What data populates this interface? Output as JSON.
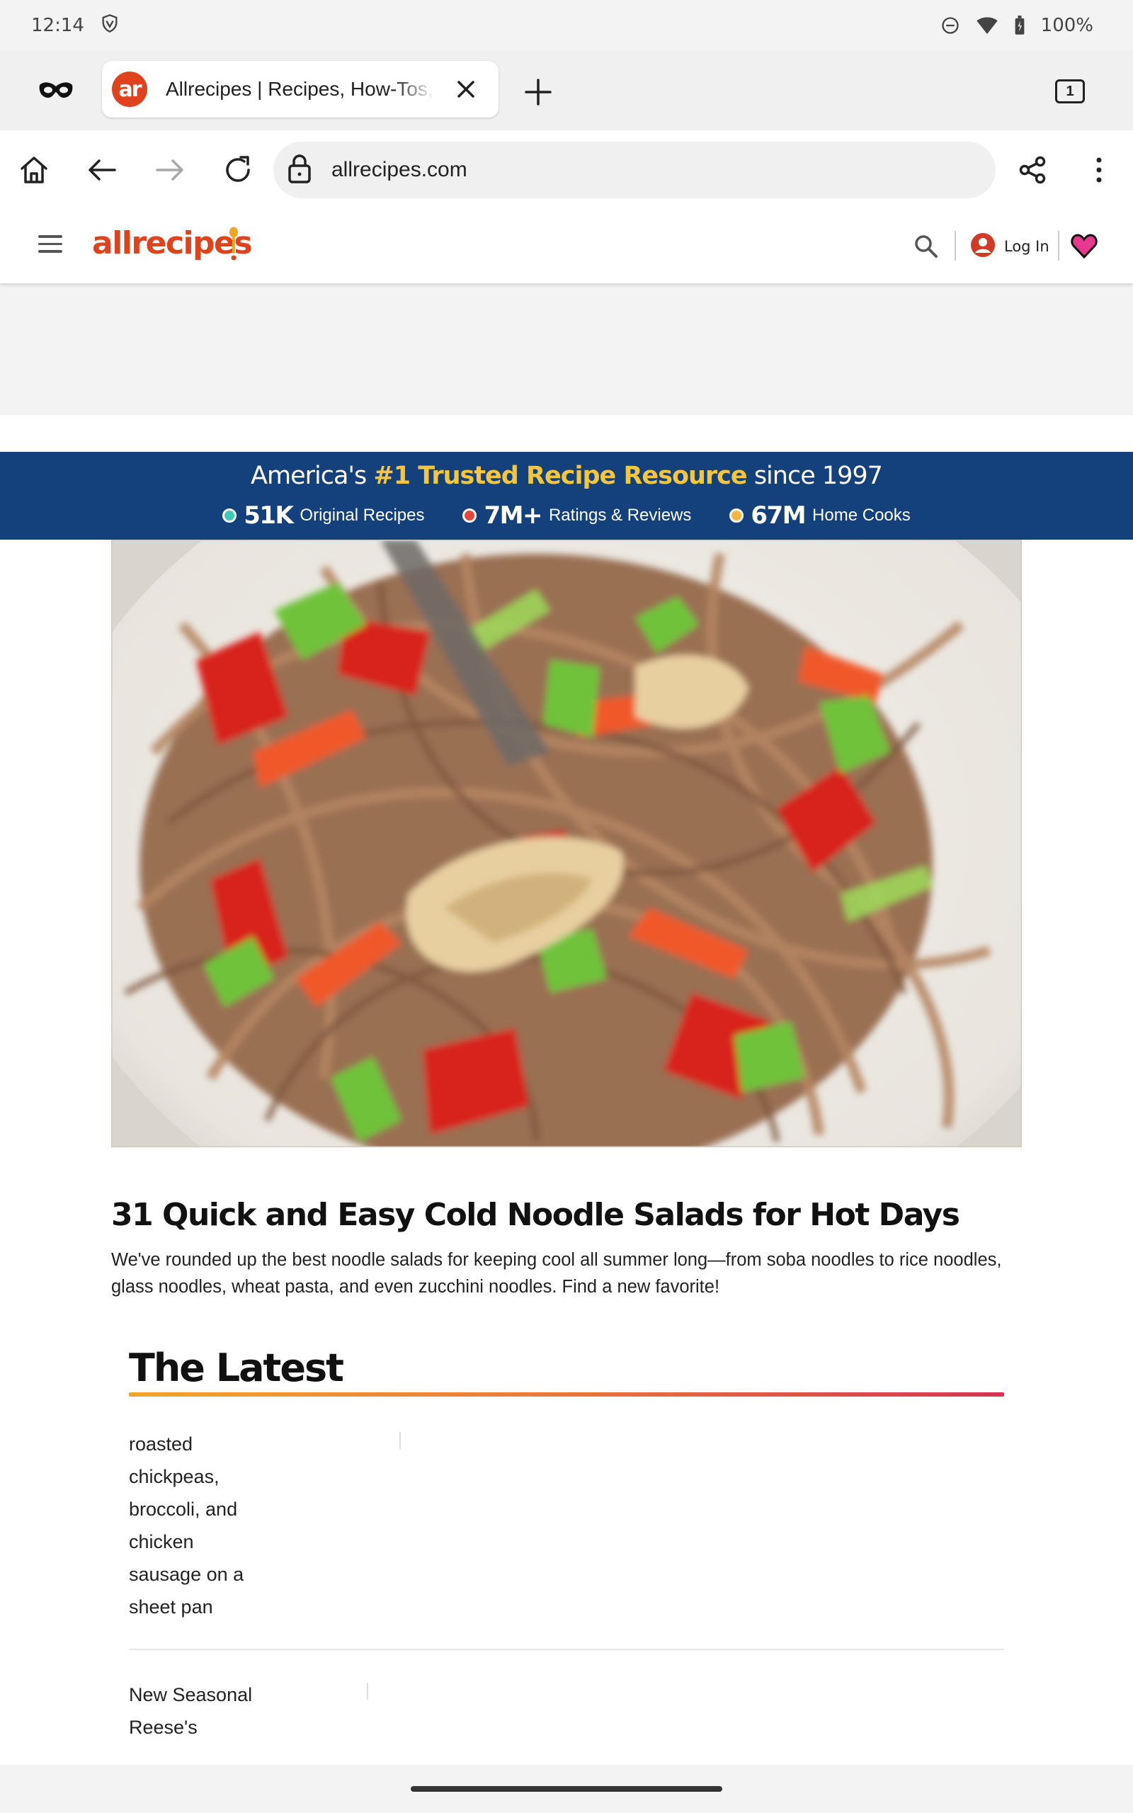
{
  "status_bar": {
    "time": "12:14",
    "battery": "100%"
  },
  "tab": {
    "favicon_text": "ar",
    "title": "Allrecipes | Recipes, How-Tos, Videos and More",
    "count": "1"
  },
  "toolbar": {
    "url": "allrecipes.com"
  },
  "site_header": {
    "logo": "allrecipes",
    "login_label": "Log In"
  },
  "trust_banner": {
    "prefix": "America's",
    "highlight": "#1 Trusted Recipe Resource",
    "suffix": "since 1997",
    "stats": [
      {
        "number": "51K",
        "label": "Original Recipes",
        "color": "#3fc9b2"
      },
      {
        "number": "7M+",
        "label": "Ratings & Reviews",
        "color": "#e8453c"
      },
      {
        "number": "67M",
        "label": "Home Cooks",
        "color": "#f3b63f"
      }
    ]
  },
  "article": {
    "title": "31 Quick and Easy Cold Noodle Salads for Hot Days",
    "description": "We've rounded up the best noodle salads for keeping cool all summer long—from soba noodles to rice noodles, glass noodles, wheat pasta, and even zucchini noodles. Find a new favorite!"
  },
  "latest": {
    "heading": "The Latest",
    "items": [
      {
        "lines": [
          "roasted",
          "chickpeas,",
          "broccoli, and",
          "chicken",
          "sausage on a",
          "sheet pan"
        ]
      },
      {
        "lines": [
          "New Seasonal",
          "Reese's"
        ]
      }
    ]
  },
  "colors": {
    "brand": "#e0421d",
    "banner_bg": "#14407b",
    "banner_highlight": "#f4c63d"
  }
}
